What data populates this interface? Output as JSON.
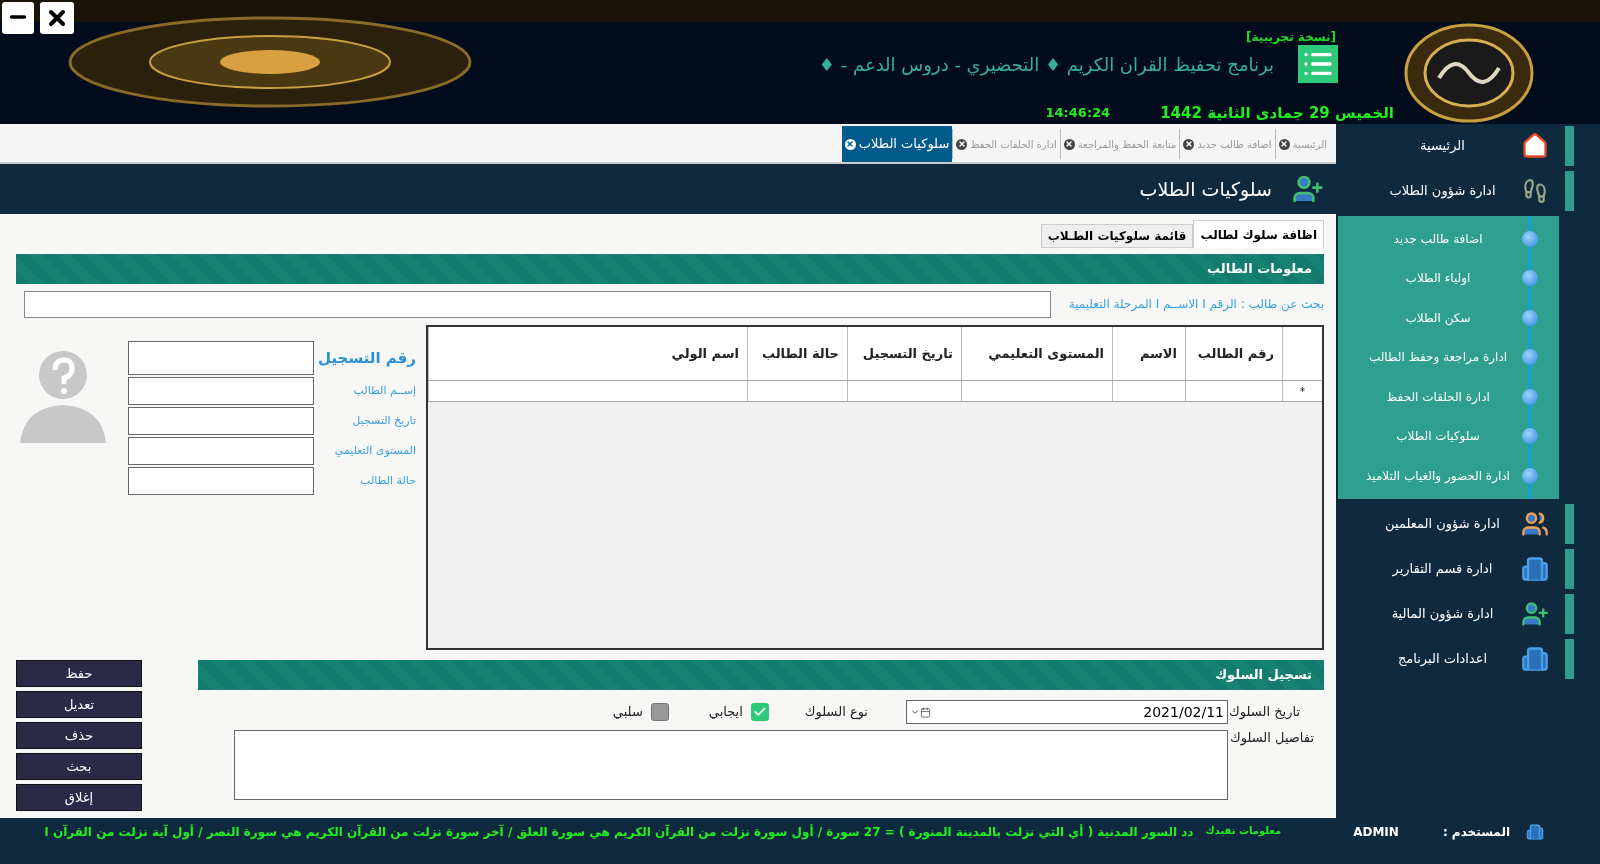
{
  "header": {
    "badge": "[نسخة تجريبية]",
    "title": "برنامج تحفيظ القران الكريم ♦ التحضيري - دروس الدعم - ♦",
    "date": "الخميس 29 جمادى الثانية 1442",
    "time": "14:46:24"
  },
  "tabs": [
    {
      "label": "الرئيسية",
      "selected": false
    },
    {
      "label": "اضافة طالب جديد",
      "selected": false
    },
    {
      "label": "متابعة الحفظ والمراجعة",
      "selected": false
    },
    {
      "label": "ادارة الحلقات الحفظ",
      "selected": false
    },
    {
      "label": "سلوكيات الطلاب",
      "selected": true
    }
  ],
  "page_title": "سلوكيات الطلاب",
  "sub_tabs": [
    {
      "label": "اظافة سلوك لطالب",
      "selected": true
    },
    {
      "label": "قائمة سلوكيات الطـلاب",
      "selected": false
    }
  ],
  "student_info": {
    "title": "معلومات الطالب",
    "search_label": "بحث عن طالب : الرقم I الاســم I المرحلة التعليمية",
    "fields": [
      {
        "label": "رقم التسجيل",
        "kind": "main"
      },
      {
        "label": "إســم الطالب",
        "kind": "normal"
      },
      {
        "label": "تاريخ التسجيل",
        "kind": "normal"
      },
      {
        "label": "المستوى التعليمي",
        "kind": "normal"
      },
      {
        "label": "حالة الطالب",
        "kind": "normal"
      }
    ]
  },
  "table": {
    "columns": [
      "رقم الطالب",
      "الاسم",
      "المستوى التعليمي",
      "تاريخ التسجيل",
      "حالة الطالب",
      "اسم الولي"
    ],
    "new_row_marker": "*"
  },
  "behavior": {
    "title": "تسجيل السلوك",
    "date_label": "تاريخ السلوك",
    "date_value": "2021/02/11",
    "type_label": "نوع السلوك",
    "options": [
      {
        "label": "ايجابي",
        "checked": true
      },
      {
        "label": "سلبي",
        "checked": false
      }
    ],
    "details_label": "تفاصيل السلوك"
  },
  "buttons": [
    "حفظ",
    "تعديل",
    "حذف",
    "بحث",
    "إغلاق"
  ],
  "sidebar": {
    "items": [
      {
        "label": "الرئيسية"
      },
      {
        "label": "ادارة شؤون الطلاب",
        "children": [
          {
            "label": "اضافة طالب جديد"
          },
          {
            "label": "اولياء الطلاب"
          },
          {
            "label": "سكن الطلاب"
          },
          {
            "label": "ادارة مراجعة وحفظ الطالب"
          },
          {
            "label": "ادارة الحلقات الحفظ"
          },
          {
            "label": "سلوكيات الطلاب"
          },
          {
            "label": "ادارة الحضور والغياب التلاميذ"
          }
        ]
      },
      {
        "label": "ادارة شؤون المعلمين"
      },
      {
        "label": "ادارة قسم التقارير"
      },
      {
        "label": "ادارة شؤون المالية"
      },
      {
        "label": "اعدادات البرنامج"
      }
    ]
  },
  "status_bar": {
    "ticker": "دد السور المدنية ( أي التي نزلت بالمدينة المنورة ) = 27 سورة / أول سورة نزلت من القرآن الكريم هي سورة العلق / آخر سورة نزلت من القرآن الكريم هي سورة النصر / أول آية نزلت من القرآن ا",
    "info_label": "معلومات تقيدك",
    "user_label": "المستخدم :",
    "user": "ADMIN"
  }
}
